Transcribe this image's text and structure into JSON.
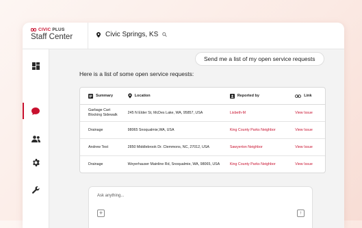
{
  "brand": {
    "logo": "CIVICPLUS",
    "logo_prefix": "CIVIC",
    "logo_suffix": "PLUS",
    "subtitle": "Staff Center",
    "accent": "#c8102e"
  },
  "location": {
    "name": "Civic Springs, KS",
    "icon": "map-pin-icon",
    "search_icon": "search-icon"
  },
  "sidebar": {
    "items": [
      {
        "icon": "dashboard-icon",
        "active": false
      },
      {
        "icon": "chat-icon",
        "active": true
      },
      {
        "icon": "people-icon",
        "active": false
      },
      {
        "icon": "settings-gear-icon",
        "active": false
      },
      {
        "icon": "wrench-icon",
        "active": false
      }
    ]
  },
  "chat": {
    "user_message": "Send me a list of my open service requests",
    "reply": "Here is a list of some open service requests:"
  },
  "table": {
    "headers": [
      "Summary",
      "Location",
      "Reported by",
      "Link"
    ],
    "rows": [
      {
        "summary": "Garbage Cart Blocking Sidewalk",
        "location": "245 N Elder St, McDes Lake, WA, 95857, USA",
        "reported_by": "Lisbeth-M",
        "link": "View Issue"
      },
      {
        "summary": "Drainage",
        "location": "98065 Snoqualmie,WA, USA",
        "reported_by": "King County Parks Neighbor",
        "link": "View Issue"
      },
      {
        "summary": "Andrew Test",
        "location": "2850 Middlebrook Dr. Clemmons, NC, 27012, USA",
        "reported_by": "Sawyerton Neighbor",
        "link": "View Issue"
      },
      {
        "summary": "Drainage",
        "location": "Weyerhauser Mainline Rd, Snoqualmie, WA, 98065, USA",
        "reported_by": "King County Parks Neighbor",
        "link": "View Issue"
      }
    ]
  },
  "composer": {
    "placeholder": "Ask anything...",
    "add_icon": "plus-icon",
    "send_icon": "arrow-up-icon"
  }
}
